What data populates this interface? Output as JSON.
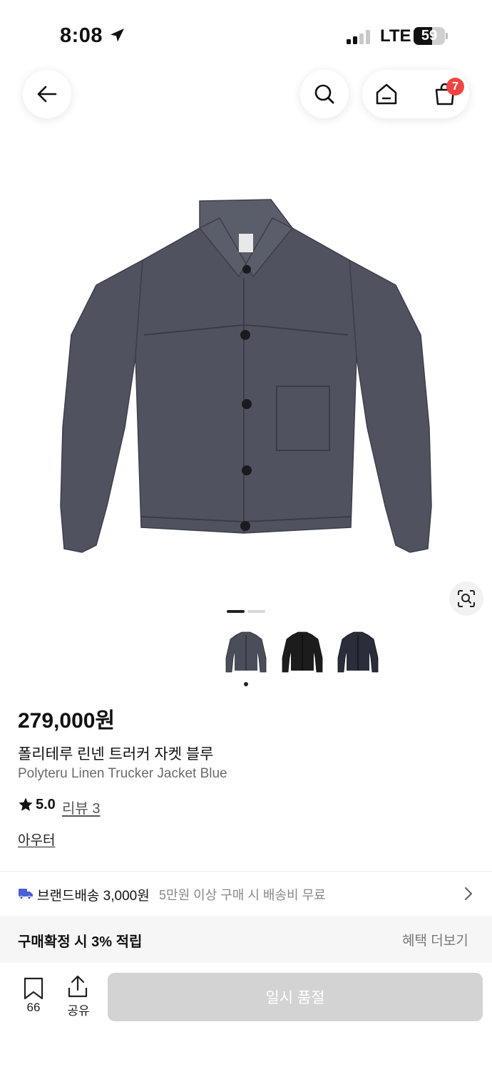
{
  "status_bar": {
    "time": "8:08",
    "network": "LTE",
    "battery": "59",
    "battery_level": 0.59,
    "icons": [
      "location-arrow-icon",
      "signal-icon",
      "battery-icon"
    ]
  },
  "top_nav": {
    "icons": [
      "back-arrow-icon",
      "search-icon",
      "home-icon",
      "cart-icon"
    ],
    "cart_badge": "7",
    "badge_color": "#ef4444"
  },
  "gallery": {
    "page_count": 2,
    "current_page": 1,
    "thumbnails": [
      {
        "name": "thumb-blue",
        "color": "#4a4d5a"
      },
      {
        "name": "thumb-black",
        "color": "#1c1c1c"
      },
      {
        "name": "thumb-navy",
        "color": "#2a2d3a"
      }
    ],
    "selected_thumbnail": 0,
    "jacket_color": "#50535f"
  },
  "product": {
    "price": "279,000원",
    "name_ko": "폴리테루 린넨 트러커 자켓 블루",
    "name_en": "Polyteru Linen Trucker Jacket Blue",
    "rating": "5.0",
    "review_link": "리뷰 3",
    "category": "아우터"
  },
  "shipping": {
    "label": "브랜드배송 3,000원",
    "note": "5만원 이상 구매 시 배송비 무료",
    "icon_color": "#4b5fd6"
  },
  "benefit": {
    "text": "구매확정 시 3% 적립",
    "more": "혜택 더보기"
  },
  "bottom_bar": {
    "bookmark_count": "66",
    "share_label": "공유",
    "purchase_button": "일시 품절"
  }
}
